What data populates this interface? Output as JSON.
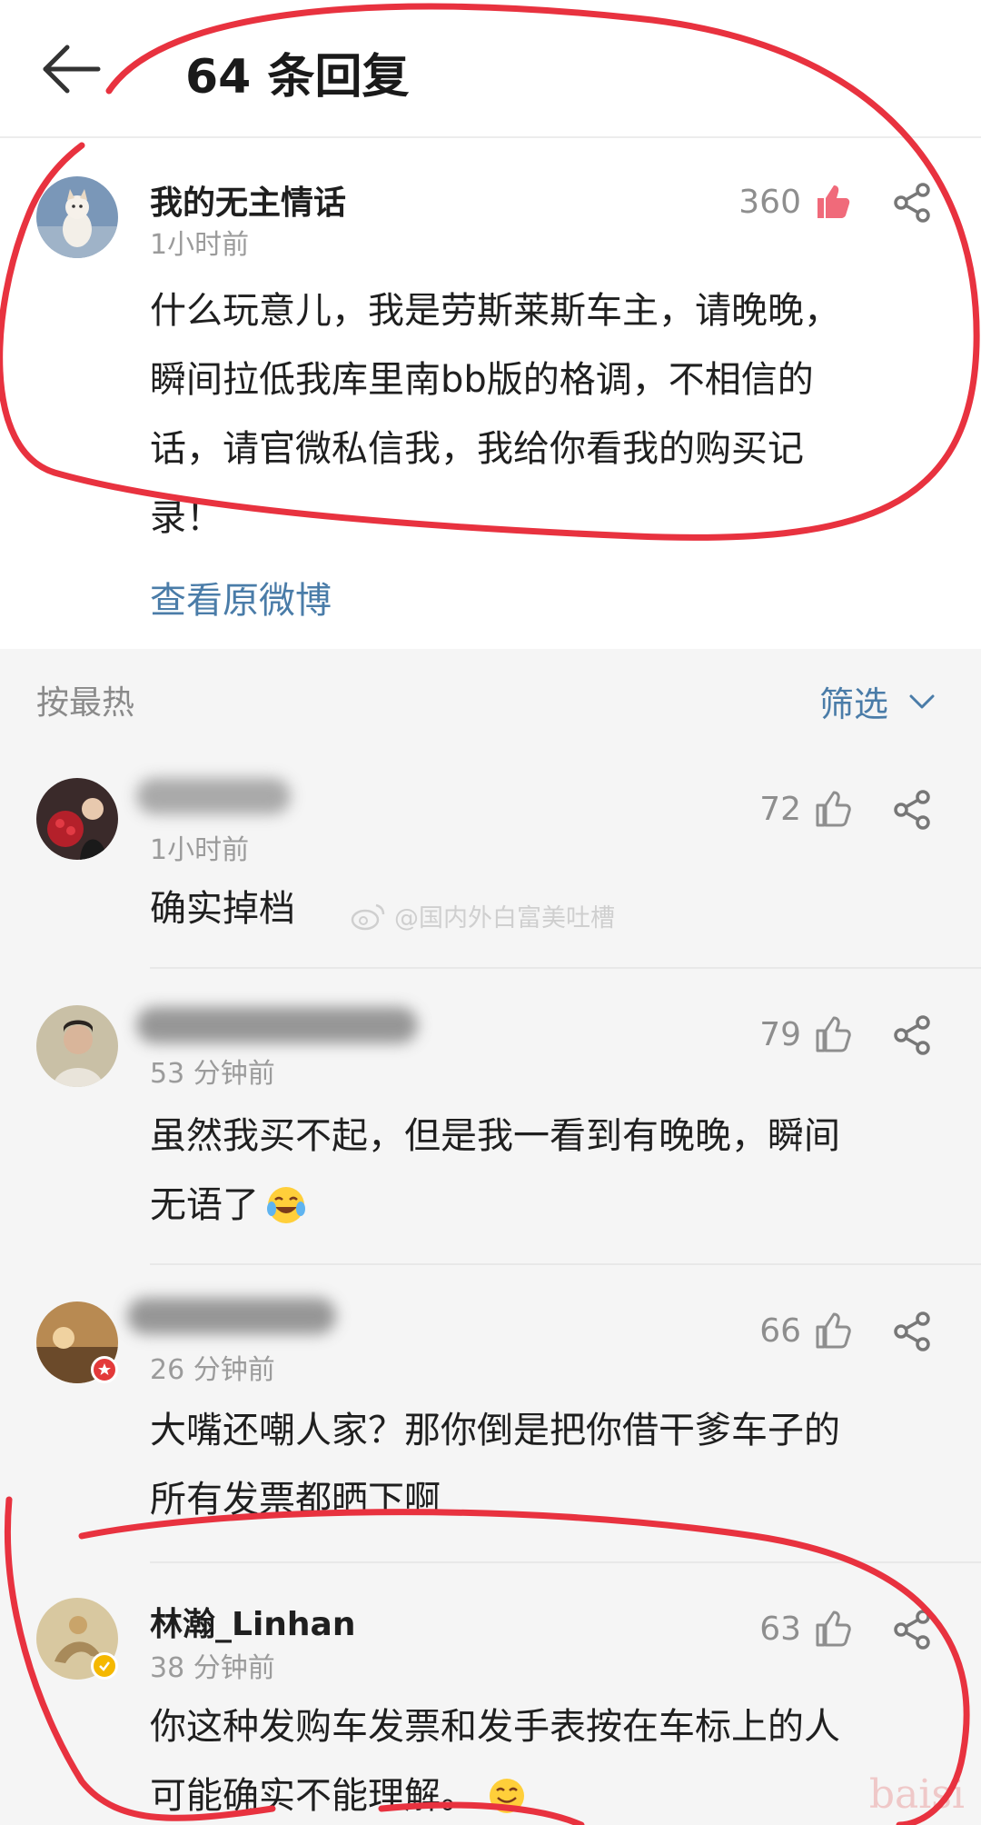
{
  "header": {
    "title": "64 条回复"
  },
  "main_comment": {
    "username": "我的无主情话",
    "time": "1小时前",
    "likes": "360",
    "content_lines": [
      "什么玩意儿，我是劳斯莱斯车主，请晚晚，",
      "瞬间拉低我库里南bb版的格调，不相信的",
      "话，请官微私信我，我给你看我的购买记",
      "录！"
    ],
    "view_original": "查看原微博"
  },
  "sort_bar": {
    "label": "按最热",
    "filter": "筛选"
  },
  "watermark": "@国内外白富美吐槽",
  "replies": [
    {
      "time": "1小时前",
      "likes": "72",
      "lines": [
        "确实掉档"
      ]
    },
    {
      "time": "53 分钟前",
      "likes": "79",
      "lines": [
        "虽然我买不起，但是我一看到有晚晚，瞬间",
        "无语了"
      ]
    },
    {
      "time": "26 分钟前",
      "likes": "66",
      "lines": [
        "大嘴还嘲人家？那你倒是把你借干爹车子的",
        "所有发票都晒下啊"
      ]
    },
    {
      "username": "林瀚_Linhan",
      "time": "38 分钟前",
      "likes": "63",
      "lines": [
        "你这种发购车发票和发手表按在车标上的人",
        "可能确实不能理解。"
      ]
    }
  ],
  "corner_mark": "baisi",
  "colors": {
    "link": "#4a7ca8",
    "liked": "#f06a7a",
    "annotation": "#e8323f"
  }
}
